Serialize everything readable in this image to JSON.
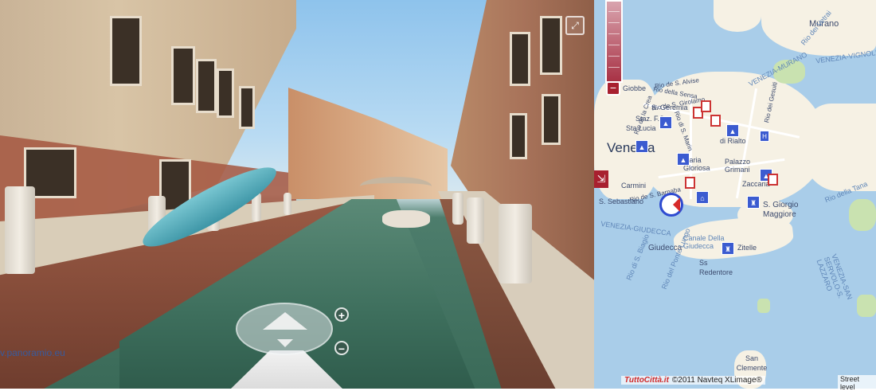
{
  "panorama": {
    "watermark": "v.panoramio.eu",
    "controls": {
      "zoom_in_label": "+",
      "zoom_out_label": "−",
      "fullscreen_icon": "expand-icon"
    }
  },
  "map": {
    "city_label": "Venezia",
    "labels": [
      {
        "id": "murano",
        "text": "Murano"
      },
      {
        "id": "rio-vetrai",
        "text": "Rio dei Vetrai"
      },
      {
        "id": "venezia-murano",
        "text": "VENEZIA-MURANO"
      },
      {
        "id": "venezia-vignole",
        "text": "VENEZIA-VIGNOLE"
      },
      {
        "id": "rio-s-alvise",
        "text": "Rio de S. Alvise"
      },
      {
        "id": "rio-sensa",
        "text": "Rio della Sensa"
      },
      {
        "id": "rio-s-girolamo",
        "text": "Rio de S. Girolamo"
      },
      {
        "id": "giobbe",
        "text": "Giobbe"
      },
      {
        "id": "s-geremia",
        "text": "S. Geremia"
      },
      {
        "id": "staz-fs",
        "text": "Staz. F.S."
      },
      {
        "id": "sta-lucia",
        "text": "Sta Lucia"
      },
      {
        "id": "rio-crea",
        "text": "Rio de la Crea"
      },
      {
        "id": "rio-gesuiti",
        "text": "Rio dei Gesuiti"
      },
      {
        "id": "rio-s-marin",
        "text": "Rio di S. Marin"
      },
      {
        "id": "di-rialto",
        "text": "di Rialto"
      },
      {
        "id": "maria-gloriosa",
        "text": "Maria Gloriosa"
      },
      {
        "id": "palazzo-grimani",
        "text": "Palazzo Grimani"
      },
      {
        "id": "zaccaria",
        "text": "Zaccaria"
      },
      {
        "id": "carmini",
        "text": "Carmini"
      },
      {
        "id": "rio-s-barnaba",
        "text": "Rio de S. Barnaba"
      },
      {
        "id": "s-sebastiano",
        "text": "S. Sebastiano"
      },
      {
        "id": "s-giorgio-maggiore",
        "text": "S. Giorgio Maggiore"
      },
      {
        "id": "rio-della-tana",
        "text": "Rio della Tana"
      },
      {
        "id": "venezia-giudecca",
        "text": "VENEZIA-GIUDECCA"
      },
      {
        "id": "canale-giudecca",
        "text": "Canale Della Giudecca"
      },
      {
        "id": "giudecca",
        "text": "Giudecca"
      },
      {
        "id": "zitelle",
        "text": "Zitelle"
      },
      {
        "id": "ss-redentore",
        "text": "Ss Redentore"
      },
      {
        "id": "rio-s-biagio",
        "text": "Rio di S. Biagio"
      },
      {
        "id": "rio-ponte-lungo",
        "text": "Rio del Ponte Lungo"
      },
      {
        "id": "venezia-lazzaro",
        "text": "VENEZIA-SAN SERVOLO-S. LAZZARO"
      },
      {
        "id": "san-clemente",
        "text": "San Clemente"
      }
    ],
    "attribution": {
      "brand": "TuttoCittà.it",
      "text": "©2011 Navteq XLimage®"
    },
    "street_level_label": "Street level",
    "controls": {
      "zoom_out_label": "−",
      "collapse_label": "⇲"
    }
  }
}
